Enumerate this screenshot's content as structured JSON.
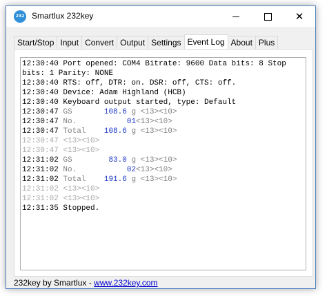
{
  "window": {
    "title": "Smartlux 232key",
    "icon_text": "232",
    "icon": "app-logo-icon",
    "controls": [
      "minimize-icon",
      "maximize-icon",
      "close-icon"
    ]
  },
  "tabs": [
    "Start/Stop",
    "Input",
    "Convert",
    "Output",
    "Settings",
    "Event Log",
    "About",
    "Plus"
  ],
  "active_tab": "Event Log",
  "log": {
    "header": [
      "12:30:40 Port opened: COM4 Bitrate: 9600 Data bits: 8 Stop bits: 1 Parity: NONE",
      "12:30:40 RTS: off, DTR: on. DSR: off, CTS: off.",
      "12:30:40 Device: Adam Highland (HCB)",
      "12:30:40 Keyboard output started, type: Default"
    ],
    "entries": [
      {
        "time": "12:30:47",
        "label": "GS      ",
        "pad": " ",
        "value": "108.6",
        "rest": " g <13><10>",
        "style": "gray"
      },
      {
        "time": "12:30:47",
        "label": "No.     ",
        "pad": "      ",
        "value": "01",
        "rest": "<13><10>",
        "style": "gray"
      },
      {
        "time": "12:30:47",
        "label": "Total   ",
        "pad": " ",
        "value": "108.6",
        "rest": " g <13><10>",
        "style": "gray"
      },
      {
        "time": "12:30:47",
        "label": "<13><10>",
        "pad": "",
        "value": "",
        "rest": "",
        "style": "light"
      },
      {
        "time": "12:30:47",
        "label": "<13><10>",
        "pad": "",
        "value": "",
        "rest": "",
        "style": "light"
      },
      {
        "time": "12:31:02",
        "label": "GS      ",
        "pad": "  ",
        "value": "83.0",
        "rest": " g <13><10>",
        "style": "gray"
      },
      {
        "time": "12:31:02",
        "label": "No.     ",
        "pad": "      ",
        "value": "02",
        "rest": "<13><10>",
        "style": "gray"
      },
      {
        "time": "12:31:02",
        "label": "Total   ",
        "pad": " ",
        "value": "191.6",
        "rest": " g <13><10>",
        "style": "gray"
      },
      {
        "time": "12:31:02",
        "label": "<13><10>",
        "pad": "",
        "value": "",
        "rest": "",
        "style": "light"
      },
      {
        "time": "12:31:02",
        "label": "<13><10>",
        "pad": "",
        "value": "",
        "rest": "",
        "style": "light"
      }
    ],
    "footer": "12:31:35 Stopped."
  },
  "status": {
    "prefix": "232key by Smartlux - ",
    "link_text": "www.232key.com"
  },
  "colors": {
    "value_blue": "#1a37c8",
    "entry_gray": "#808080",
    "entry_light": "#a8a8a8",
    "link": "#0000cc"
  }
}
